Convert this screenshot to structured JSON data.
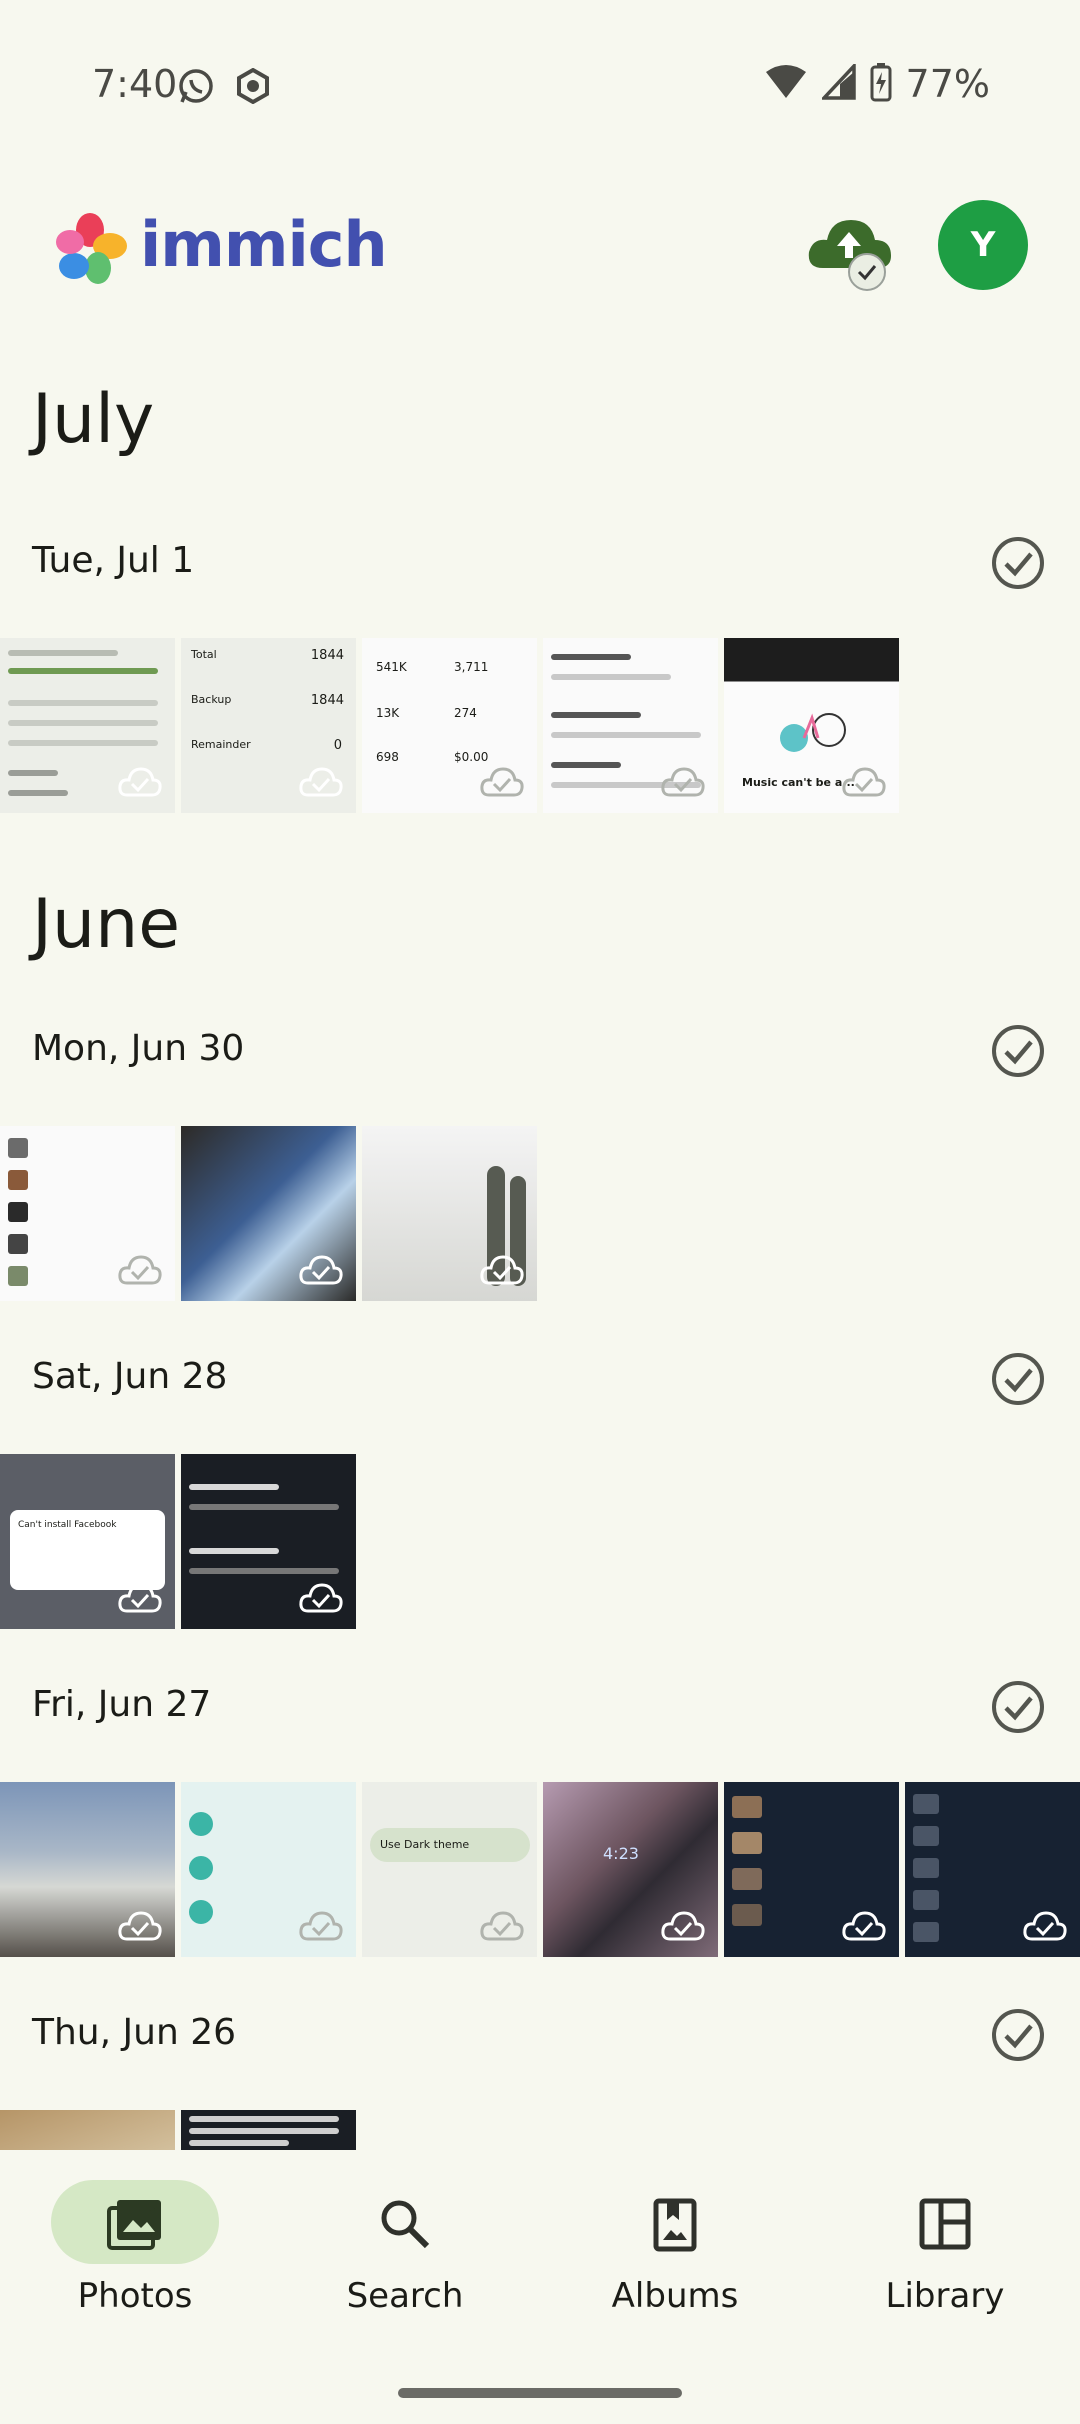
{
  "status_bar": {
    "time": "7:40",
    "battery": "77%"
  },
  "header": {
    "app_name": "immich",
    "avatar_letter": "Y"
  },
  "timeline": {
    "months": [
      {
        "label": "July"
      },
      {
        "label": "June"
      }
    ],
    "days": [
      {
        "label": "Tue, Jul 1",
        "thumbnail_count": 5
      },
      {
        "label": "Mon, Jun 30",
        "thumbnail_count": 3
      },
      {
        "label": "Sat, Jun 28",
        "thumbnail_count": 2
      },
      {
        "label": "Fri, Jun 27",
        "thumbnail_count": 6
      },
      {
        "label": "Thu, Jun 26",
        "thumbnail_count": 2
      }
    ]
  },
  "thumb_text": {
    "total": "Total",
    "total_value": "1844",
    "backup": "Backup",
    "backup_value": "1844",
    "remainder": "Remainder",
    "remainder_value": "0",
    "music": "Music can't be a...",
    "stats1": "541K",
    "stats2": "3,711",
    "stats3": "13K",
    "stats4": "274",
    "stats5": "698",
    "stats6": "$0.00",
    "cant_install": "Can't install Facebook",
    "use_dark": "Use Dark theme",
    "watch_time": "4:23"
  },
  "bottom_nav": {
    "items": [
      {
        "label": "Photos",
        "icon": "photos-icon",
        "active": true
      },
      {
        "label": "Search",
        "icon": "search-icon",
        "active": false
      },
      {
        "label": "Albums",
        "icon": "albums-icon",
        "active": false
      },
      {
        "label": "Library",
        "icon": "library-icon",
        "active": false
      }
    ]
  },
  "colors": {
    "background": "#f7f8ef",
    "brand": "#4250af",
    "accent_green": "#1e9e44",
    "nav_active": "#d5e8c5"
  }
}
